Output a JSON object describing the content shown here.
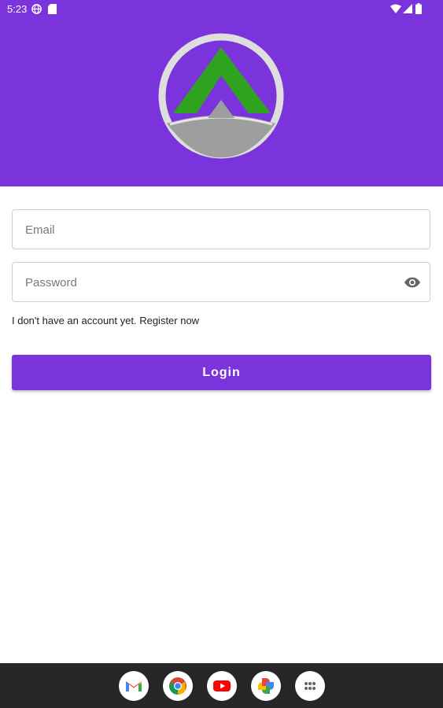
{
  "status_bar": {
    "time": "5:23",
    "icons": [
      "globe-icon",
      "sim-card-icon",
      "wifi-icon",
      "signal-icon",
      "battery-icon"
    ]
  },
  "header": {
    "background_color": "#7b34dc",
    "logo": "mountain-logo"
  },
  "form": {
    "email": {
      "placeholder": "Email",
      "value": ""
    },
    "password": {
      "placeholder": "Password",
      "value": "",
      "toggle_icon": "eye-icon"
    },
    "register_text": "I don't have an account yet. Register now",
    "login_label": "Login"
  },
  "dock": {
    "apps": [
      "gmail-icon",
      "chrome-icon",
      "youtube-icon",
      "photos-icon",
      "app-drawer-icon"
    ]
  },
  "colors": {
    "accent": "#7b34dc",
    "logo_green": "#2fa31f",
    "logo_gray": "#9e9e9e"
  }
}
